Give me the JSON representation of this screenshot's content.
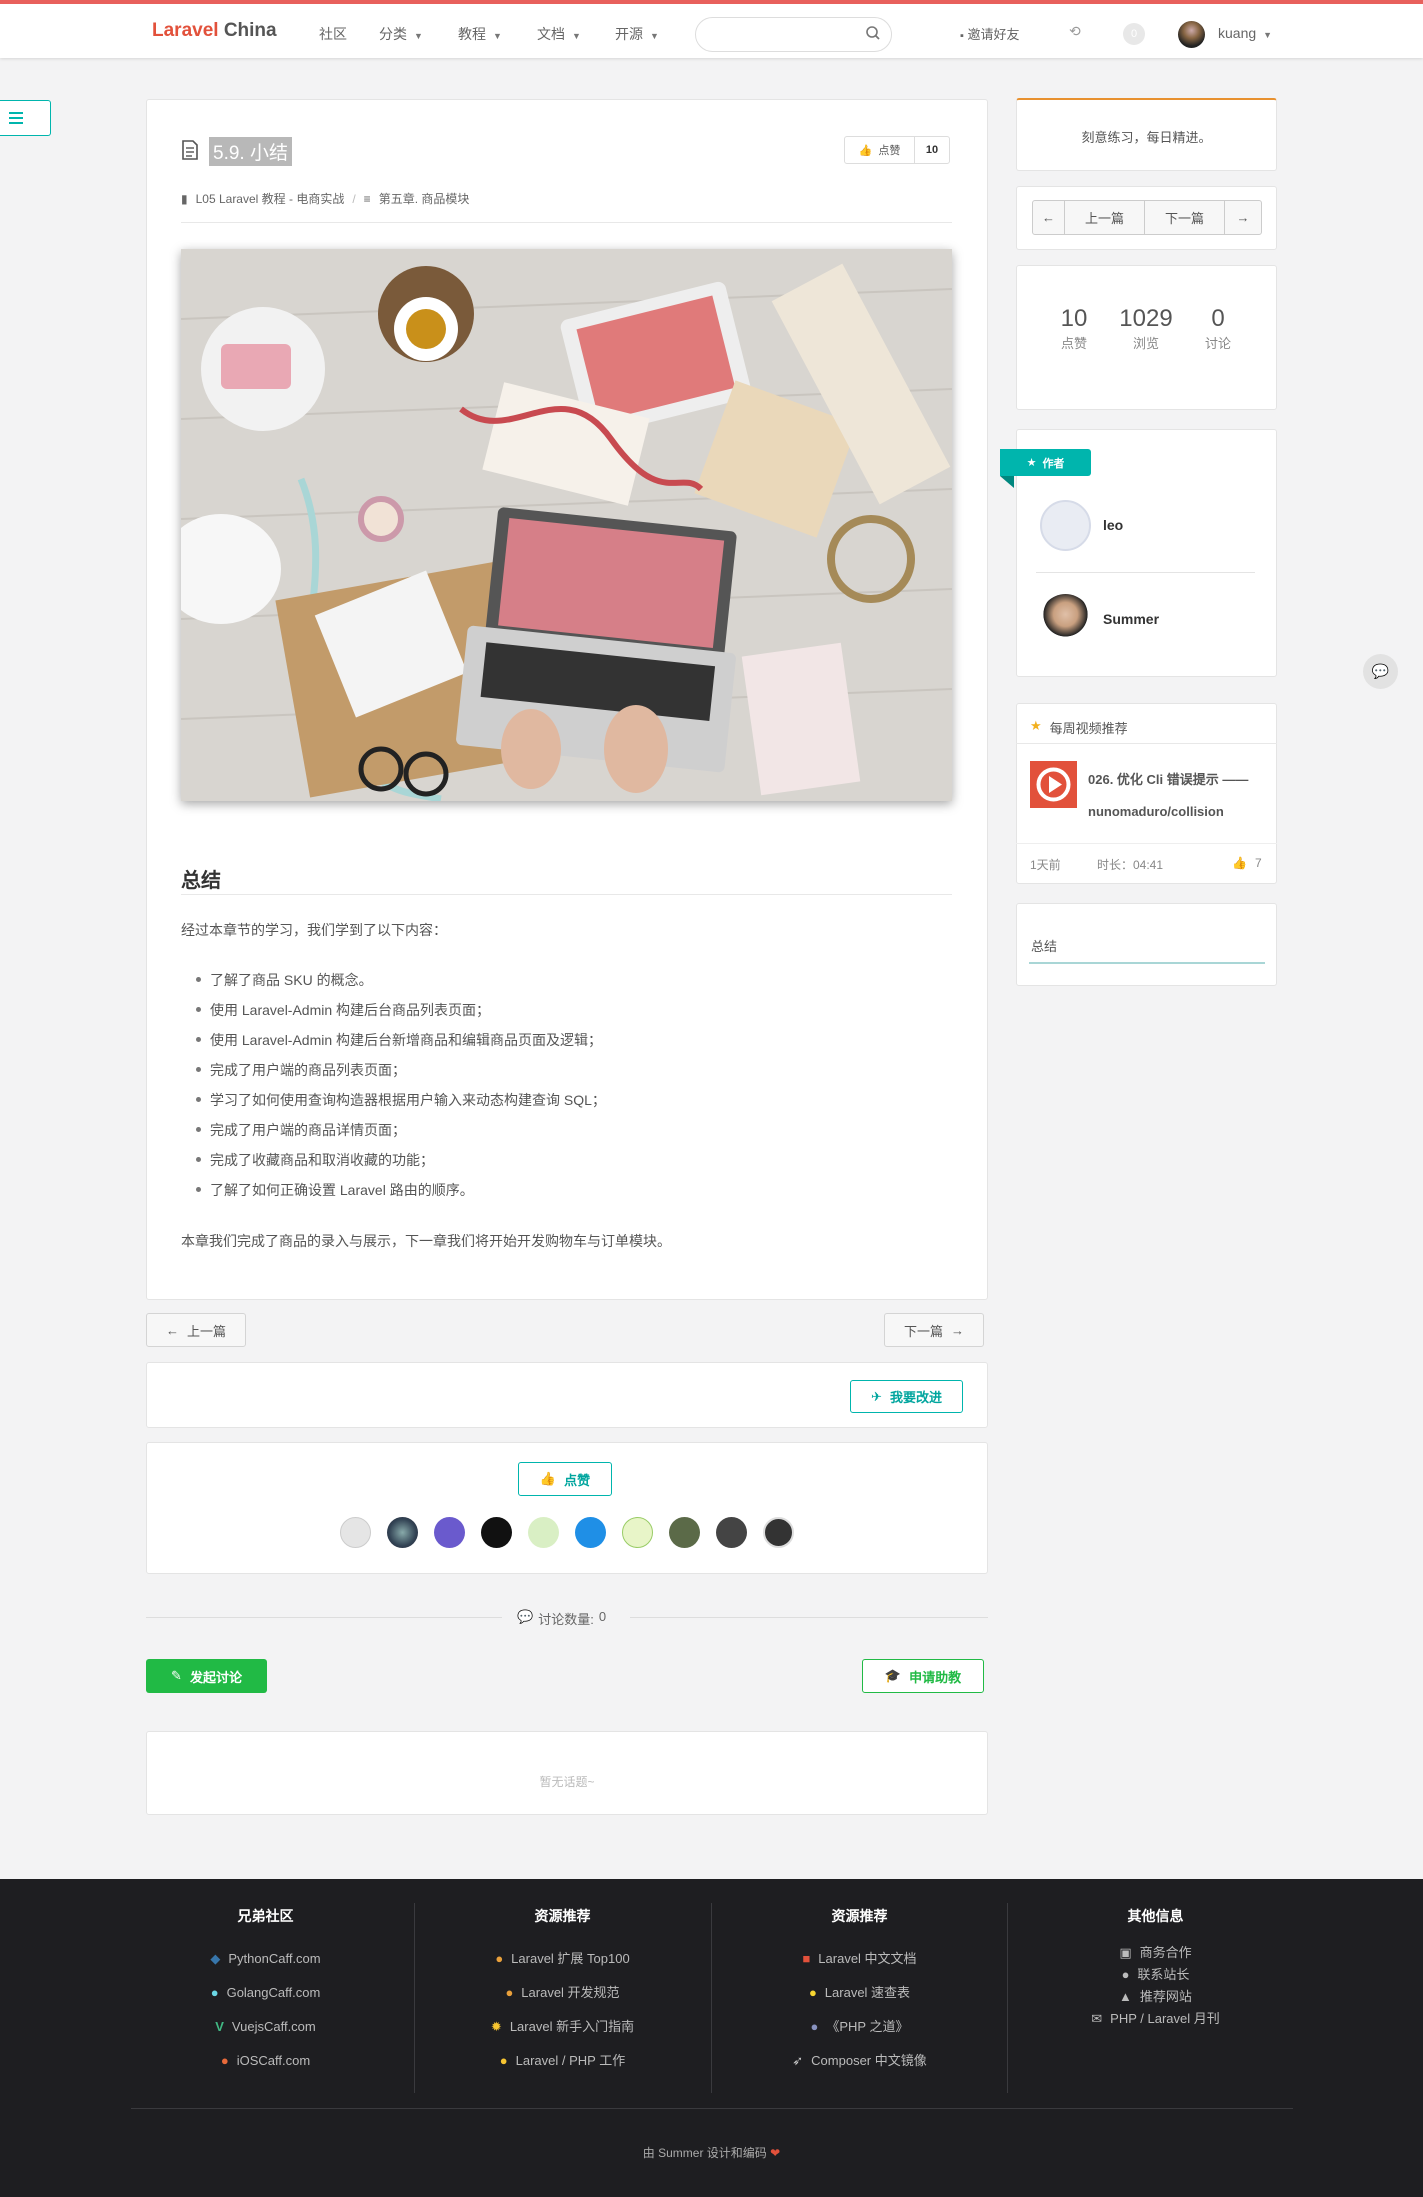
{
  "nav": {
    "brand_main": "Laravel",
    "brand_sub": "China",
    "items": [
      "社区",
      "分类",
      "教程",
      "文档",
      "开源"
    ],
    "invite": "邀请好友",
    "badge": "0",
    "user": "kuang"
  },
  "article": {
    "title": "5.9. 小结",
    "like_label": "点赞",
    "like_count": "10",
    "crumb_book": "L05 Laravel 教程 - 电商实战",
    "crumb_sep": "/",
    "crumb_chapter": "第五章. 商品模块",
    "section_heading": "总结",
    "intro": "经过本章节的学习，我们学到了以下内容：",
    "items": [
      "了解了商品 SKU 的概念。",
      "使用 Laravel-Admin 构建后台商品列表页面；",
      "使用 Laravel-Admin 构建后台新增商品和编辑商品页面及逻辑；",
      "完成了用户端的商品列表页面；",
      "学习了如何使用查询构造器根据用户输入来动态构建查询 SQL；",
      "完成了用户端的商品详情页面；",
      "完成了收藏商品和取消收藏的功能；",
      "了解了如何正确设置 Laravel 路由的顺序。"
    ],
    "outro": "本章我们完成了商品的录入与展示，下一章我们将开始开发购物车与订单模块。"
  },
  "pager": {
    "prev": "上一篇",
    "next": "下一篇"
  },
  "improve": "我要改进",
  "vote": {
    "label": "点赞"
  },
  "discussion": {
    "label": "讨论数量:",
    "count": "0",
    "start": "发起讨论",
    "apply": "申请助教",
    "empty": "暂无话题~"
  },
  "sidebar": {
    "motto": "刻意练习，每日精进。",
    "prev": "上一篇",
    "next": "下一篇",
    "stats": [
      {
        "n": "10",
        "l": "点赞"
      },
      {
        "n": "1029",
        "l": "浏览"
      },
      {
        "n": "0",
        "l": "讨论"
      }
    ],
    "author_ribbon": "作者",
    "authors": [
      "leo",
      "Summer"
    ],
    "video_header": "每周视频推荐",
    "video_title": "026. 优化 Cli 错误提示 —— nunomaduro/collision",
    "video_time": "1天前",
    "video_duration": "时长：04:41",
    "video_likes": "7",
    "toc_item": "总结"
  },
  "footer": {
    "cols": [
      {
        "title": "兄弟社区",
        "items": [
          "PythonCaff.com",
          "GolangCaff.com",
          "VuejsCaff.com",
          "iOSCaff.com"
        ]
      },
      {
        "title": "资源推荐",
        "items": [
          "Laravel 扩展 Top100",
          "Laravel 开发规范",
          "Laravel 新手入门指南",
          "Laravel / PHP 工作"
        ]
      },
      {
        "title": "资源推荐",
        "items": [
          "Laravel 中文文档",
          "Laravel 速查表",
          "《PHP 之道》",
          "Composer 中文镜像"
        ]
      },
      {
        "title": "其他信息",
        "items": [
          "商务合作",
          "联系站长",
          "推荐网站",
          "PHP / Laravel 月刊"
        ]
      }
    ],
    "credit": "由 Summer 设计和编码"
  },
  "colors": {
    "brand": "#e2513b",
    "teal": "#00b5ad",
    "green": "#21ba45",
    "footer_bg": "#1e1e21"
  }
}
